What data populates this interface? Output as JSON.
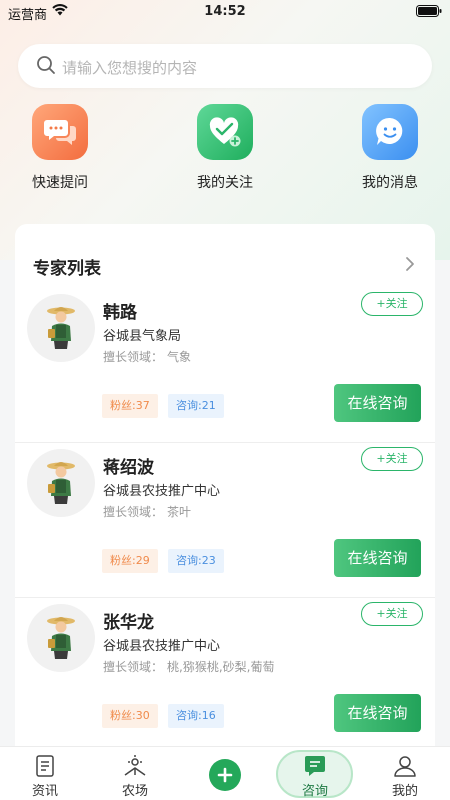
{
  "status": {
    "carrier": "运营商",
    "time": "14:52"
  },
  "search": {
    "placeholder": "请输入您想搜的内容"
  },
  "quick_actions": [
    {
      "label": "快速提问",
      "icon": "chat-bubbles-icon",
      "color": "#f47a48"
    },
    {
      "label": "我的关注",
      "icon": "heart-plus-icon",
      "color": "#2bb56a"
    },
    {
      "label": "我的消息",
      "icon": "smiley-bubble-icon",
      "color": "#4a97f0"
    }
  ],
  "expert_list": {
    "title": "专家列表",
    "field_label": "擅长领域：",
    "follow_label": "+关注",
    "consult_label": "在线咨询",
    "experts": [
      {
        "name": "韩路",
        "org": "谷城县气象局",
        "field": "气象",
        "fans": "粉丝:37",
        "consults": "咨询:21"
      },
      {
        "name": "蒋绍波",
        "org": "谷城县农技推广中心",
        "field": "茶叶",
        "fans": "粉丝:29",
        "consults": "咨询:23"
      },
      {
        "name": "张华龙",
        "org": "谷城县农技推广中心",
        "field": "桃,猕猴桃,砂梨,葡萄",
        "fans": "粉丝:30",
        "consults": "咨询:16"
      }
    ]
  },
  "tabbar": {
    "items": [
      {
        "label": "资讯",
        "icon": "news-icon"
      },
      {
        "label": "农场",
        "icon": "farm-icon"
      },
      {
        "label": "咨询",
        "icon": "consult-icon",
        "active": true
      },
      {
        "label": "我的",
        "icon": "profile-icon"
      }
    ],
    "add_icon": "plus-icon"
  },
  "colors": {
    "accent": "#2bb56a",
    "fans_badge": "#f08a4b",
    "consult_badge": "#4a8fdf"
  }
}
